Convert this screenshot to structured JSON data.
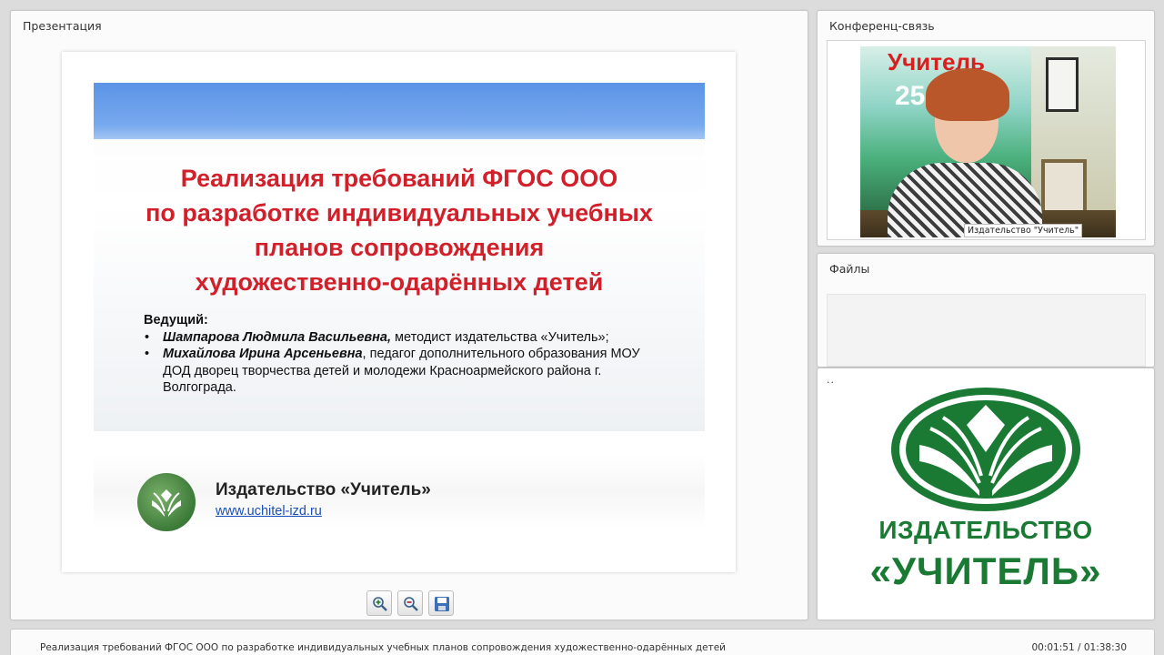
{
  "panels": {
    "presentation_title": "Презентация",
    "conference_title": "Конференц-связь",
    "files_title": "Файлы"
  },
  "slide": {
    "title_lines": [
      "Реализация требований ФГОС ООО",
      "по разработке индивидуальных учебных",
      "планов сопровождения",
      "художественно-одарённых детей"
    ],
    "lead_label": "Ведущий:",
    "presenters": [
      {
        "name": "Шампарова Людмила Васильевна,",
        "role": " методист издательства «Учитель»;"
      },
      {
        "name": "Михайлова Ирина Арсеньевна",
        "role": ", педагог дополнительного образования МОУ ДОД дворец творчества детей и молодежи Красноармейского района г. Волгограда."
      }
    ],
    "footer_name": "Издательство «Учитель»",
    "footer_url": "www.uchitel-izd.ru"
  },
  "toolbar": {
    "zoom_in_icon": "zoom-in-icon",
    "zoom_out_icon": "zoom-out-icon",
    "save_icon": "save-icon"
  },
  "video": {
    "poster_text": "Учитель",
    "poster_number": "25",
    "label": "Издательство \"Учитель\""
  },
  "logo_panel": {
    "dots": "..",
    "word1": "ИЗДАТЕЛЬСТВО",
    "word2": "«УЧИТЕЛЬ»"
  },
  "status": {
    "title": "Реализация требований ФГОС ООО по разработке индивидуальных учебных планов сопровождения художественно-одарённых детей",
    "time": "00:01:51 / 01:38:30"
  },
  "colors": {
    "slide_title_red": "#d2202a",
    "brand_green": "#1a7a34",
    "slide_band_blue": "#5b93e6"
  }
}
